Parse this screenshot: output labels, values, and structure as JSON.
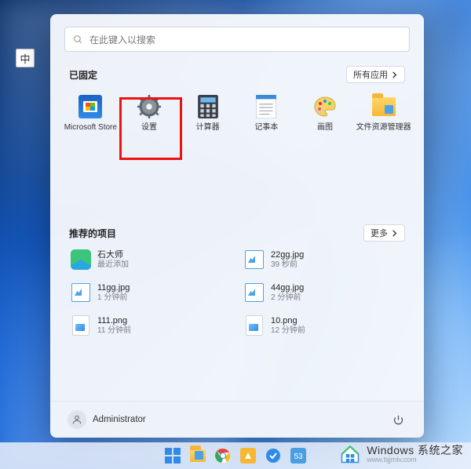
{
  "ime_badge": "中",
  "search": {
    "placeholder": "在此键入以搜索"
  },
  "pinned": {
    "title": "已固定",
    "all_apps_label": "所有应用",
    "apps": [
      {
        "name": "Microsoft Store"
      },
      {
        "name": "设置"
      },
      {
        "name": "计算器"
      },
      {
        "name": "记事本"
      },
      {
        "name": "画图"
      },
      {
        "name": "文件资源管理器"
      }
    ]
  },
  "recommended": {
    "title": "推荐的项目",
    "more_label": "更多",
    "items": [
      {
        "title": "石大师",
        "subtitle": "最近添加",
        "icon": "sds"
      },
      {
        "title": "22gg.jpg",
        "subtitle": "39 秒前",
        "icon": "jpg"
      },
      {
        "title": "11gg.jpg",
        "subtitle": "1 分钟前",
        "icon": "jpg"
      },
      {
        "title": "44gg.jpg",
        "subtitle": "2 分钟前",
        "icon": "jpg"
      },
      {
        "title": "111.png",
        "subtitle": "11 分钟前",
        "icon": "png"
      },
      {
        "title": "10.png",
        "subtitle": "12 分钟前",
        "icon": "png"
      }
    ]
  },
  "footer": {
    "username": "Administrator"
  },
  "watermark": {
    "brand": "Windows 系统之家",
    "url": "www.bjjmlv.com"
  }
}
